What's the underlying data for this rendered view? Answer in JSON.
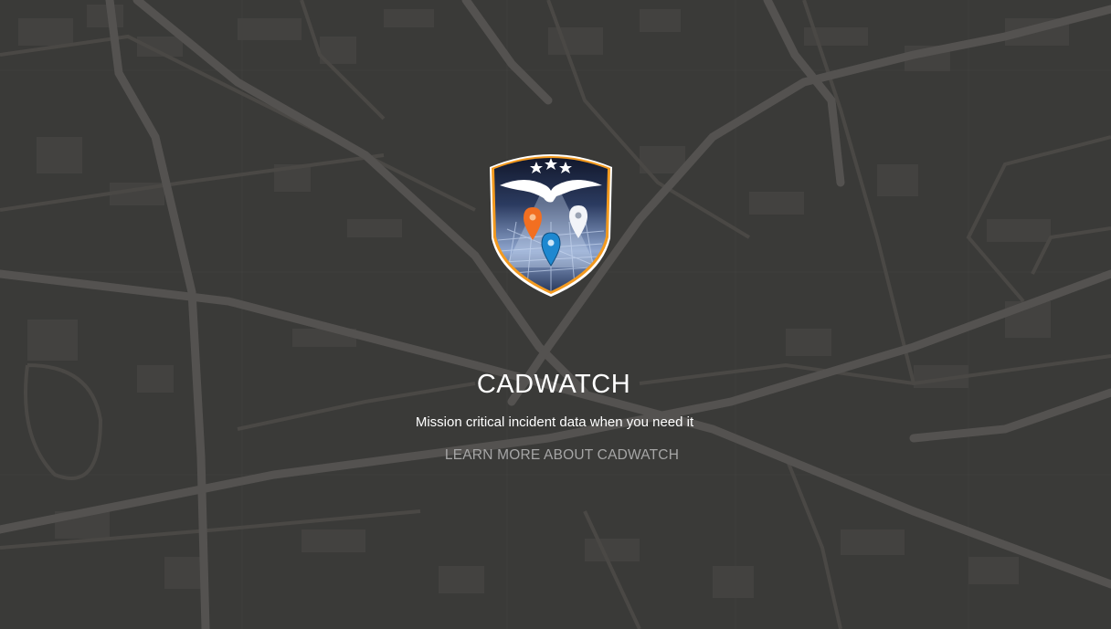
{
  "hero": {
    "title": "CADWATCH",
    "subtitle": "Mission critical incident data when you need it",
    "learn_more_label": "LEARN MORE ABOUT CADWATCH"
  },
  "logo": {
    "icon": "shield-eagle-map-pins-icon",
    "pins": [
      "orange",
      "blue",
      "white"
    ]
  },
  "colors": {
    "background": "#3a3a38",
    "road": "#4a4845",
    "major_road": "#545250",
    "block": "#434240",
    "shield_border": "#f39a1f",
    "shield_inner": "#1d2a44",
    "pin_orange": "#f26f21",
    "pin_blue": "#1e88d0",
    "link_text": "#a6a6a6"
  }
}
